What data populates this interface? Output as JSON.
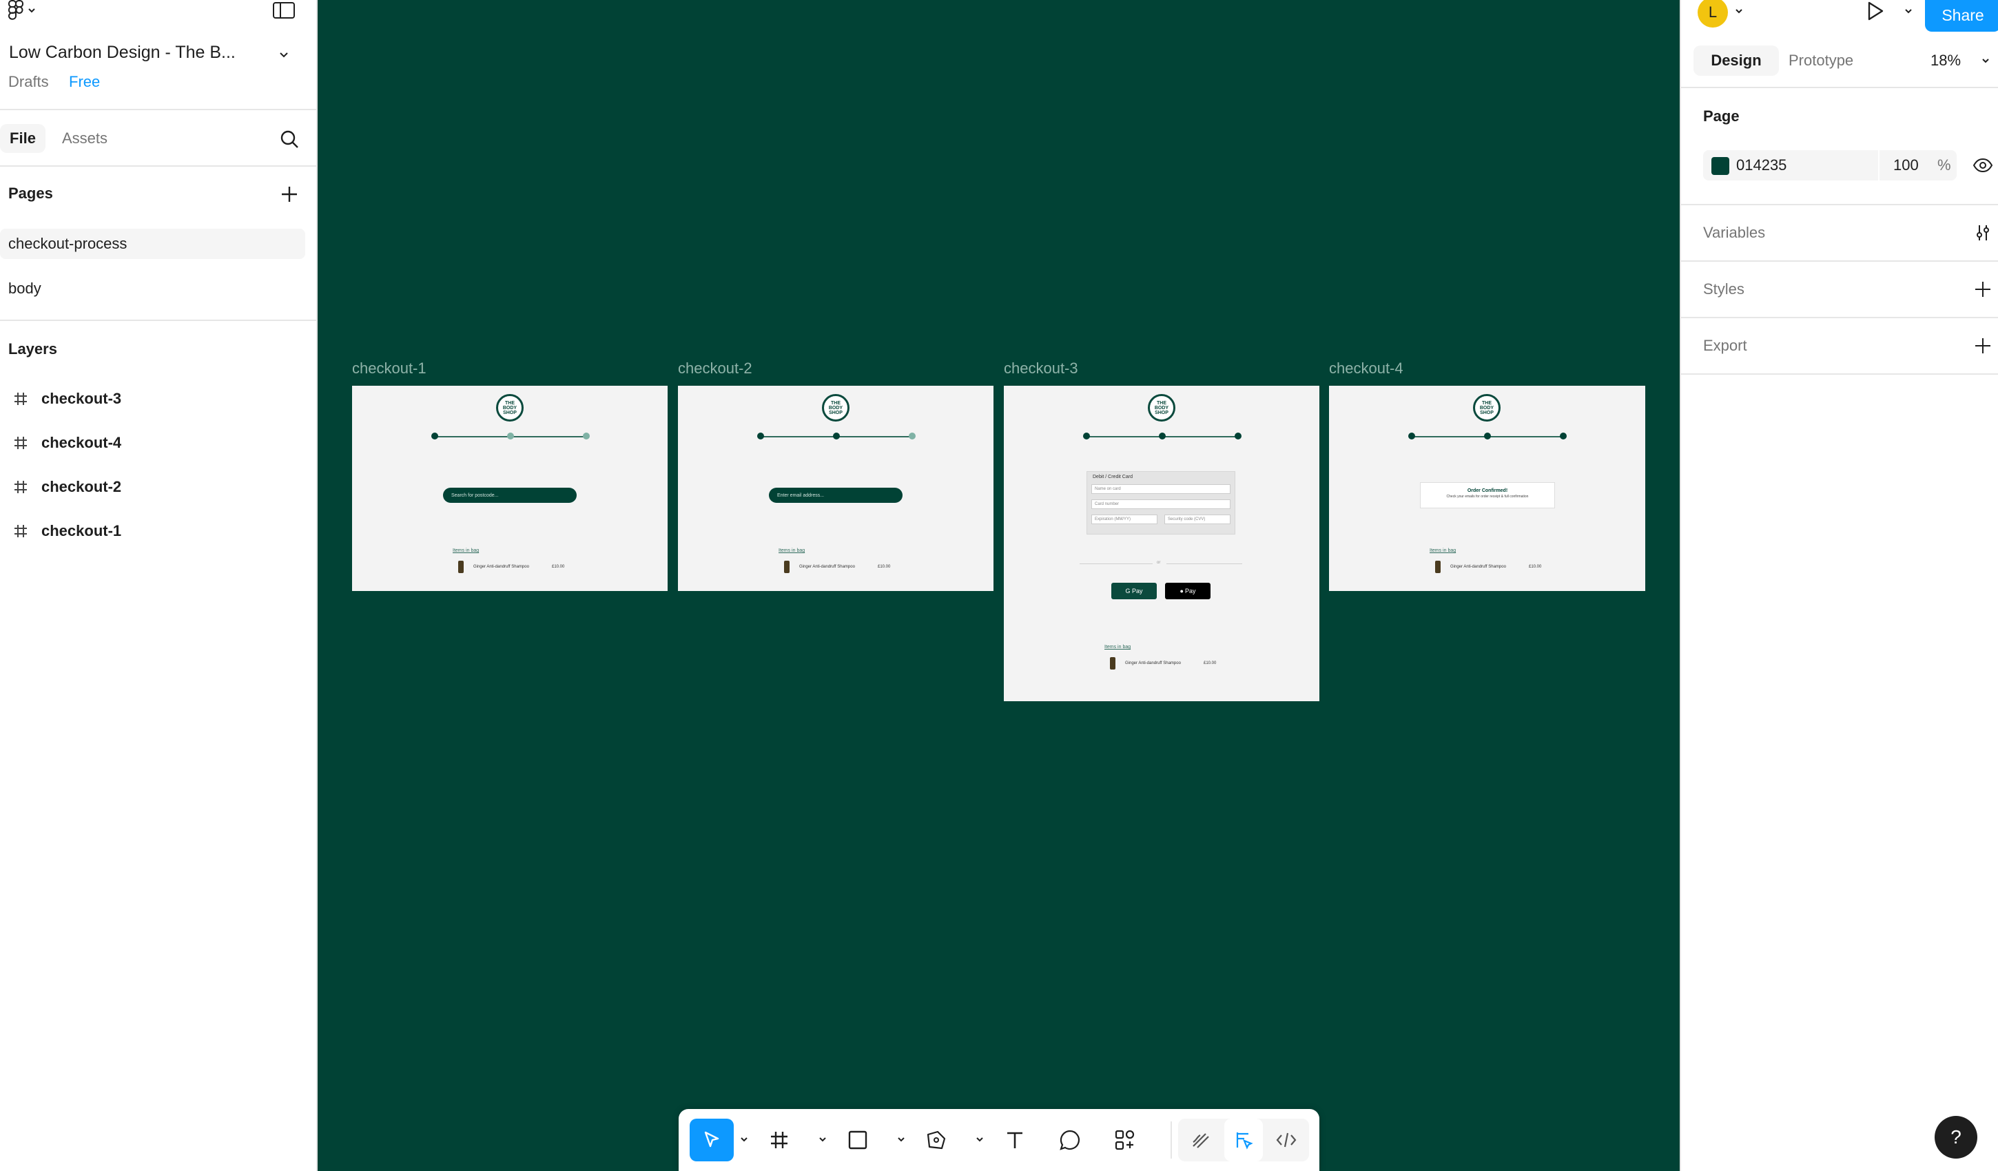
{
  "left_panel": {
    "file_title": "Low Carbon Design - The B...",
    "project": "Drafts",
    "plan_badge": "Free",
    "tabs": [
      "File",
      "Assets"
    ],
    "pages_title": "Pages",
    "pages": [
      "checkout-process",
      "body"
    ],
    "selected_page": "checkout-process",
    "layers_title": "Layers",
    "layers": [
      "checkout-3",
      "checkout-4",
      "checkout-2",
      "checkout-1"
    ]
  },
  "canvas": {
    "background": "#014235",
    "frames": [
      {
        "label": "checkout-1",
        "field_placeholder": "Search for postcode...",
        "items_link": "Items in bag",
        "product": "Ginger Anti-dandruff Shampoo",
        "price": "£10.00"
      },
      {
        "label": "checkout-2",
        "field_placeholder": "Enter email address...",
        "items_link": "Items in bag",
        "product": "Ginger Anti-dandruff Shampoo",
        "price": "£10.00"
      },
      {
        "label": "checkout-3",
        "card_title": "Debit / Credit Card",
        "card_fields": [
          "Name on card",
          "Card number",
          "Expiration (MM/YY)",
          "Security code (CVV)"
        ],
        "or_text": "or",
        "gpay": "G Pay",
        "applepay": "Pay",
        "items_link": "Items in bag",
        "product": "Ginger Anti-dandruff Shampoo",
        "price": "£10.00"
      },
      {
        "label": "checkout-4",
        "confirm_title": "Order Confirmed!",
        "confirm_text": "Check your emails for order receipt & full confirmation",
        "items_link": "Items in bag",
        "product": "Ginger Anti-dandruff Shampoo",
        "price": "£10.00"
      }
    ],
    "brand_logo_text": "THE BODY SHOP"
  },
  "right_panel": {
    "avatar_initial": "L",
    "share_label": "Share",
    "tabs": [
      "Design",
      "Prototype"
    ],
    "zoom": "18%",
    "page_section_title": "Page",
    "fill_hex": "014235",
    "fill_opacity": "100",
    "fill_percent_sign": "%",
    "sections": [
      "Variables",
      "Styles",
      "Export"
    ]
  },
  "help_label": "?",
  "colors": {
    "accent": "#0d99ff",
    "canvas": "#014235",
    "avatar": "#f2c40f"
  }
}
